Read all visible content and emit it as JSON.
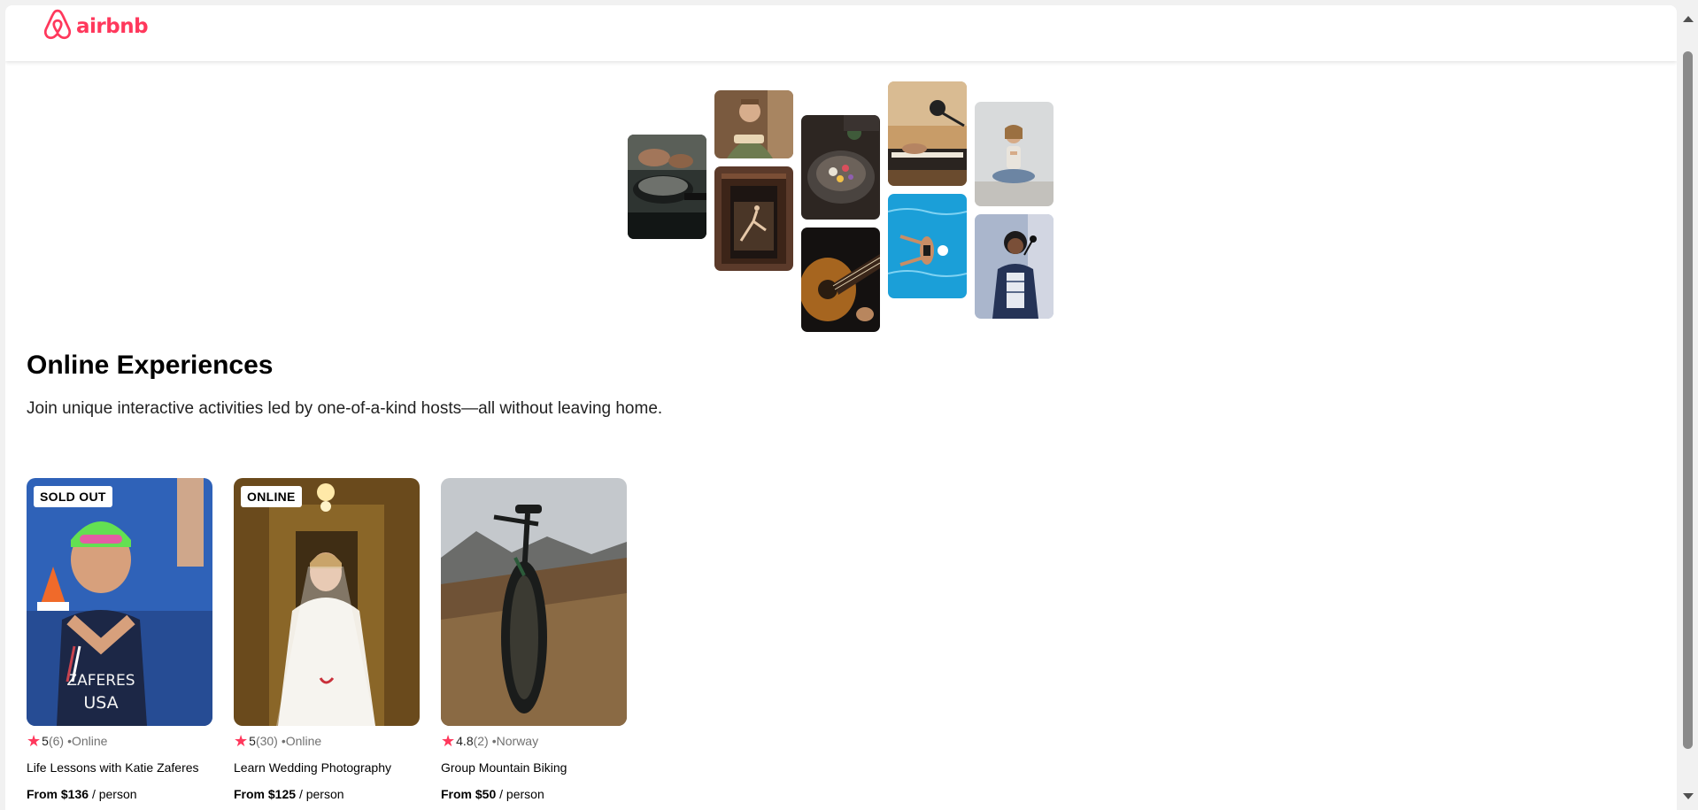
{
  "header": {
    "logo_text": "airbnb",
    "logo_icon": "airbnb-belo-icon",
    "brand_color": "#ff385c"
  },
  "collage": {
    "photos": [
      {
        "subject": "cooking pan"
      },
      {
        "subject": "woman holding food"
      },
      {
        "subject": "dancer in doorway"
      },
      {
        "subject": "bowl of food"
      },
      {
        "subject": "acoustic guitar"
      },
      {
        "subject": "piano and microphone"
      },
      {
        "subject": "swimmer in pool"
      },
      {
        "subject": "yoga pose"
      },
      {
        "subject": "singer with microphone"
      }
    ]
  },
  "hero": {
    "title": "Online Experiences",
    "subtitle": "Join unique interactive activities led by one-of-a-kind hosts—all without leaving home."
  },
  "cards": [
    {
      "badge": "SOLD OUT",
      "star": "★",
      "rating": "5",
      "reviews": "(6)",
      "location": "•Online",
      "title": "Life Lessons with Katie Zaferes",
      "price_prefix": "From",
      "price": "$136",
      "price_suffix": "/ person"
    },
    {
      "badge": "ONLINE",
      "star": "★",
      "rating": "5",
      "reviews": "(30)",
      "location": "•Online",
      "title": "Learn Wedding Photography",
      "price_prefix": "From",
      "price": "$125",
      "price_suffix": "/ person"
    },
    {
      "badge": "",
      "star": "★",
      "rating": "4.8",
      "reviews": "(2)",
      "location": "•Norway",
      "title": "Group Mountain Biking",
      "price_prefix": "From",
      "price": "$50",
      "price_suffix": "/ person"
    }
  ]
}
